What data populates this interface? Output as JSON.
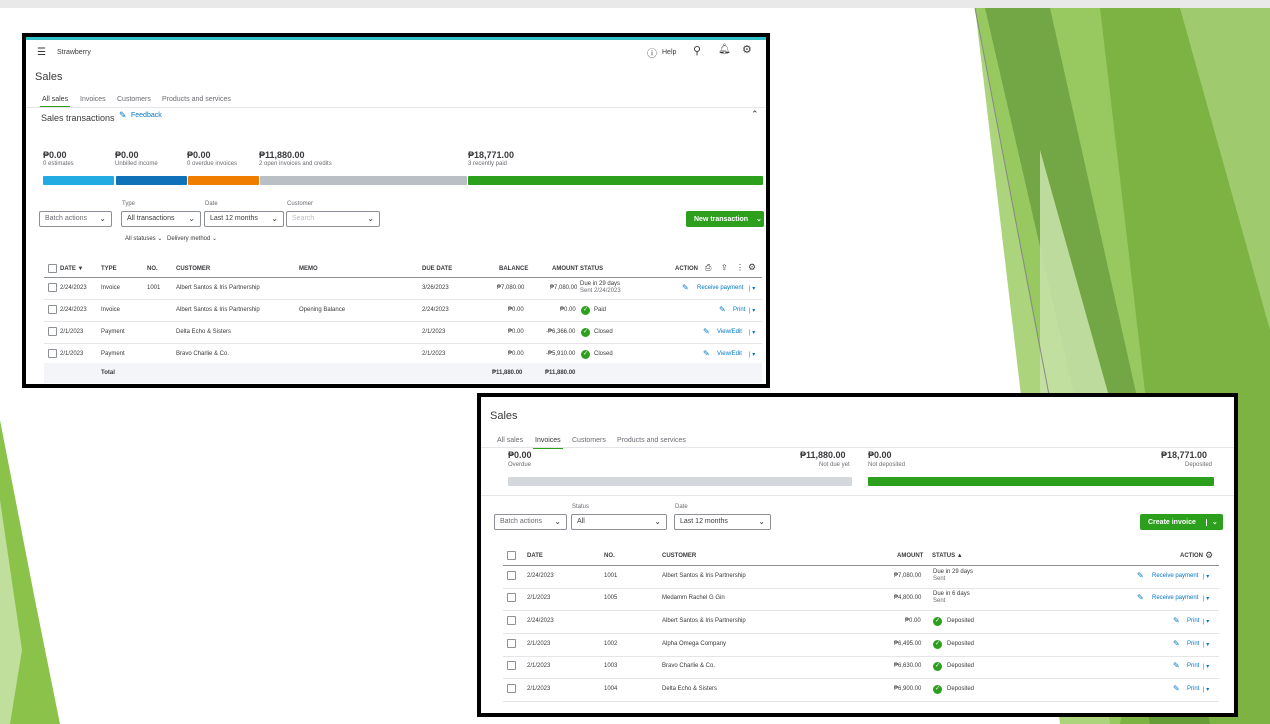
{
  "panel1": {
    "company": "Strawberry",
    "help": "Help",
    "title": "Sales",
    "tabs": [
      "All sales",
      "Invoices",
      "Customers",
      "Products and services"
    ],
    "section_title": "Sales transactions",
    "feedback": "Feedback",
    "summary": [
      {
        "amount": "₱0.00",
        "label": "0 estimates"
      },
      {
        "amount": "₱0.00",
        "label": "Unbilled income"
      },
      {
        "amount": "₱0.00",
        "label": "0 overdue invoices"
      },
      {
        "amount": "₱11,880.00",
        "label": "2 open invoices and credits"
      },
      {
        "amount": "₱18,771.00",
        "label": "3 recently paid"
      }
    ],
    "colors": {
      "estimates": "#21abe2",
      "unbilled": "#0f71b8",
      "overdue": "#f07c00",
      "open": "#babec5",
      "paid": "#2ca01c"
    },
    "filters": {
      "batch": "Batch actions",
      "type_label": "Type",
      "type_value": "All transactions",
      "date_label": "Date",
      "date_value": "Last 12 months",
      "customer_label": "Customer",
      "customer_placeholder": "Search",
      "all_statuses": "All statuses",
      "delivery": "Delivery method"
    },
    "new_transaction": "New transaction",
    "columns": {
      "date": "DATE ▼",
      "type": "TYPE",
      "no": "NO.",
      "customer": "CUSTOMER",
      "memo": "MEMO",
      "due": "DUE DATE",
      "balance": "BALANCE",
      "amount": "AMOUNT",
      "status": "STATUS",
      "action": "ACTION"
    },
    "rows": [
      {
        "date": "2/24/2023",
        "type": "Invoice",
        "no": "1001",
        "customer": "Albert Santos & Iris Partnership",
        "memo": "",
        "due": "3/26/2023",
        "balance": "₱7,080.00",
        "amount": "₱7,080.00",
        "status": "Due in 29 days",
        "status2": "Sent 2/24/2023",
        "action": "Receive payment"
      },
      {
        "date": "2/24/2023",
        "type": "Invoice",
        "no": "",
        "customer": "Albert Santos & Iris Partnership",
        "memo": "Opening Balance",
        "due": "2/24/2023",
        "balance": "₱0.00",
        "amount": "₱0.00",
        "status": "Paid",
        "status2": "",
        "action": "Print"
      },
      {
        "date": "2/1/2023",
        "type": "Payment",
        "no": "",
        "customer": "Delta Echo & Sisters",
        "memo": "",
        "due": "2/1/2023",
        "balance": "₱0.00",
        "amount": "-₱6,366.00",
        "status": "Closed",
        "status2": "",
        "action": "View/Edit"
      },
      {
        "date": "2/1/2023",
        "type": "Payment",
        "no": "",
        "customer": "Bravo Charlie & Co.",
        "memo": "",
        "due": "2/1/2023",
        "balance": "₱0.00",
        "amount": "-₱5,910.00",
        "status": "Closed",
        "status2": "",
        "action": "View/Edit"
      }
    ],
    "total": {
      "label": "Total",
      "balance": "₱11,880.00",
      "amount": "₱11,880.00"
    }
  },
  "panel2": {
    "title": "Sales",
    "tabs": [
      "All sales",
      "Invoices",
      "Customers",
      "Products and services"
    ],
    "summary": {
      "overdue_amount": "₱0.00",
      "overdue_label": "Overdue",
      "notdue_amount": "₱11,880.00",
      "notdue_label": "Not due yet",
      "notdeposited_amount": "₱0.00",
      "notdeposited_label": "Not deposited",
      "deposited_amount": "₱18,771.00",
      "deposited_label": "Deposited"
    },
    "colors": {
      "unpaid": "#d4d7dc",
      "deposited": "#2ca01c"
    },
    "filters": {
      "batch": "Batch actions",
      "status_label": "Status",
      "status_value": "All",
      "date_label": "Date",
      "date_value": "Last 12 months"
    },
    "create_invoice": "Create invoice",
    "columns": {
      "date": "DATE",
      "no": "NO.",
      "customer": "CUSTOMER",
      "amount": "AMOUNT",
      "status": "STATUS ▲",
      "action": "ACTION"
    },
    "rows": [
      {
        "date": "2/24/2023",
        "no": "1001",
        "customer": "Albert Santos & Iris Partnership",
        "amount": "₱7,080.00",
        "status": "Due in 29 days",
        "status2": "Sent",
        "action": "Receive payment"
      },
      {
        "date": "2/1/2023",
        "no": "1005",
        "customer": "Medamm Rachel G Gin",
        "amount": "₱4,800.00",
        "status": "Due in 6 days",
        "status2": "Sent",
        "action": "Receive payment"
      },
      {
        "date": "2/24/2023",
        "no": "",
        "customer": "Albert Santos & Iris Partnership",
        "amount": "₱0.00",
        "status": "Deposited",
        "status2": "",
        "action": "Print"
      },
      {
        "date": "2/1/2023",
        "no": "1002",
        "customer": "Alpha Omega Company",
        "amount": "₱6,495.00",
        "status": "Deposited",
        "status2": "",
        "action": "Print"
      },
      {
        "date": "2/1/2023",
        "no": "1003",
        "customer": "Bravo Charlie & Co.",
        "amount": "₱6,630.00",
        "status": "Deposited",
        "status2": "",
        "action": "Print"
      },
      {
        "date": "2/1/2023",
        "no": "1004",
        "customer": "Delta Echo & Sisters",
        "amount": "₱6,900.00",
        "status": "Deposited",
        "status2": "",
        "action": "Print"
      }
    ]
  }
}
